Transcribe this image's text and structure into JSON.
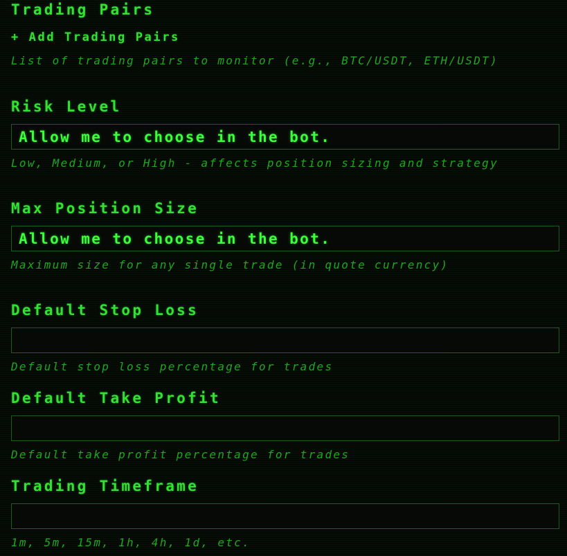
{
  "trading_pairs": {
    "label": "Trading Pairs",
    "add_button": "+ Add Trading Pairs",
    "help": "List of trading pairs to monitor (e.g., BTC/USDT, ETH/USDT)"
  },
  "risk_level": {
    "label": "Risk Level",
    "value": "Allow me to choose in the bot.",
    "help": "Low, Medium, or High - affects position sizing and strategy"
  },
  "max_position_size": {
    "label": "Max Position Size",
    "value": "Allow me to choose in the bot.",
    "help": "Maximum size for any single trade (in quote currency)"
  },
  "default_stop_loss": {
    "label": "Default Stop Loss",
    "value": "",
    "help": "Default stop loss percentage for trades"
  },
  "default_take_profit": {
    "label": "Default Take Profit",
    "value": "",
    "help": "Default take profit percentage for trades"
  },
  "trading_timeframe": {
    "label": "Trading Timeframe",
    "value": "",
    "help": "1m, 5m, 15m, 1h, 4h, 1d, etc."
  },
  "colors": {
    "background": "#060806",
    "label": "#33e033",
    "help_text": "#1ea81e",
    "input_text": "#3cff3c",
    "input_border": "#1f5a1f"
  }
}
